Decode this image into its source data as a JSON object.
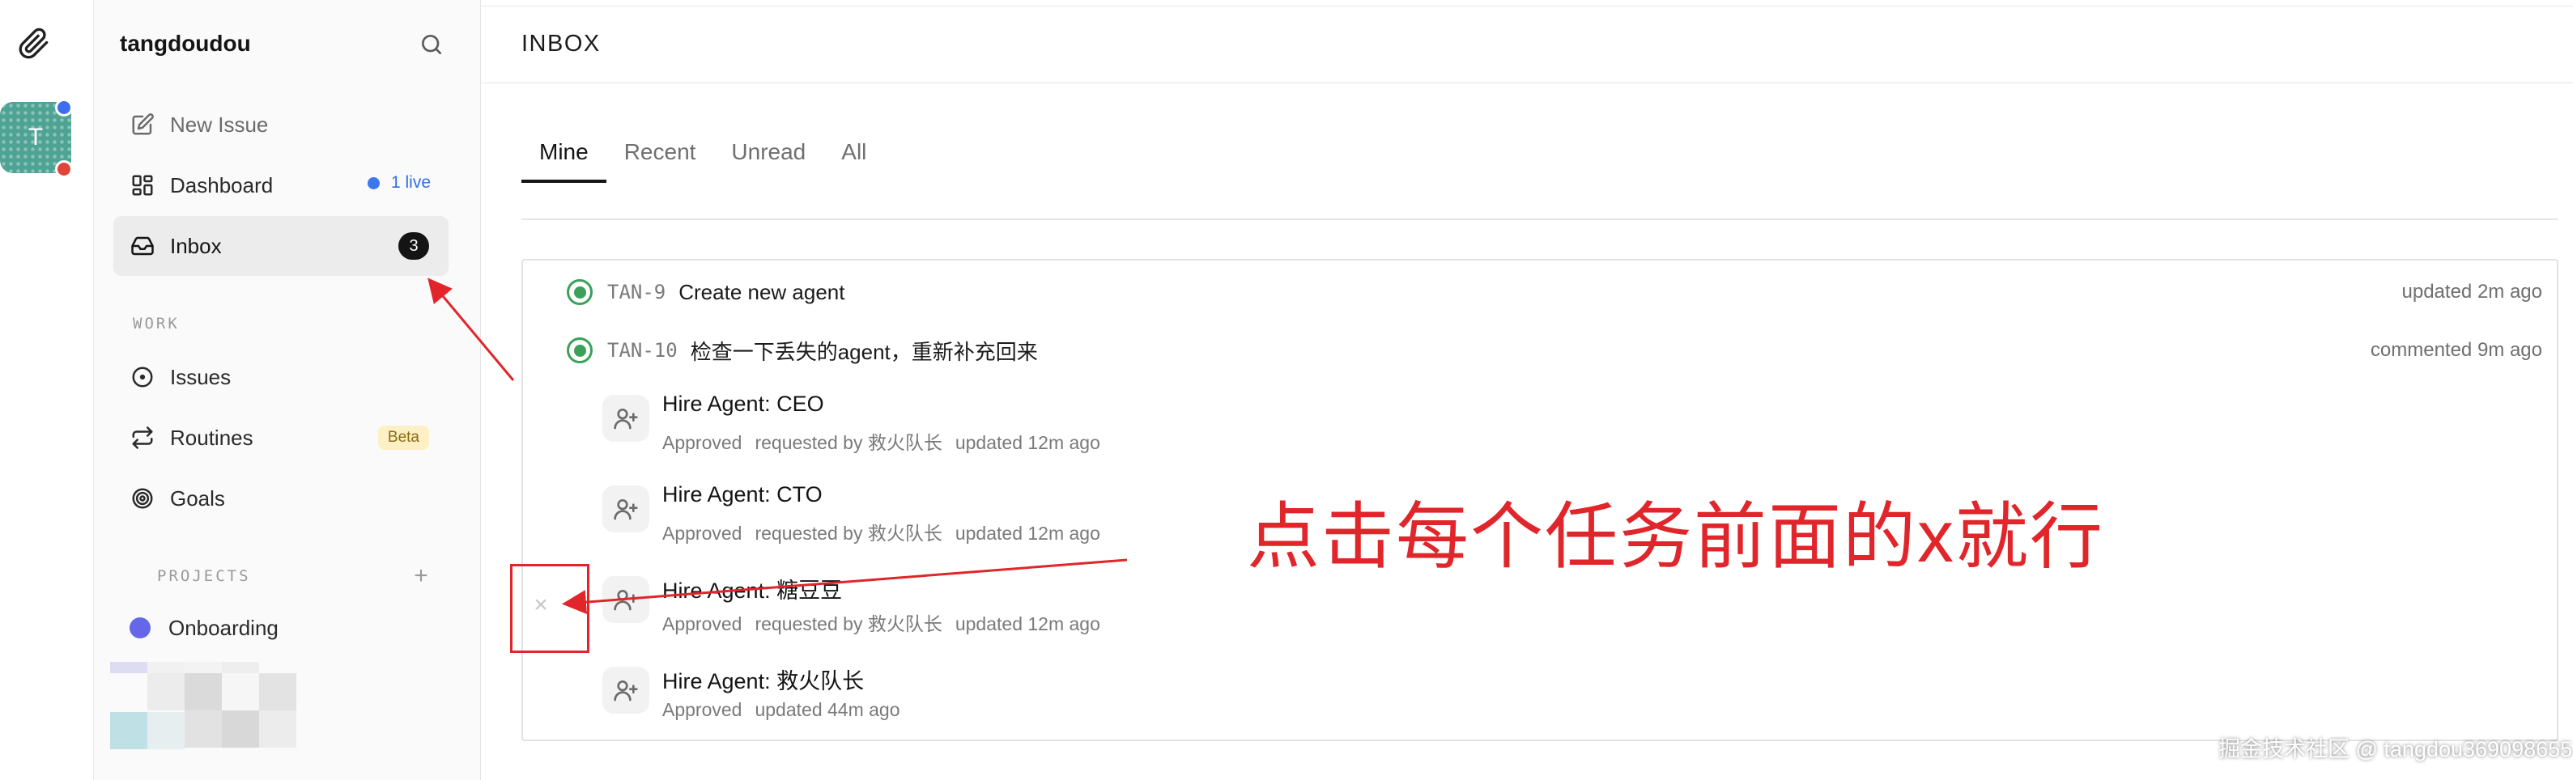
{
  "workspace": {
    "name": "tangdoudou",
    "avatar_letter": "T"
  },
  "sidebar": {
    "items": [
      {
        "label": "New Issue",
        "icon": "edit-icon"
      },
      {
        "label": "Dashboard",
        "icon": "dashboard-icon",
        "live_text": "1 live"
      },
      {
        "label": "Inbox",
        "icon": "inbox-icon",
        "badge": "3",
        "active": true
      }
    ],
    "work_label": "WORK",
    "work_items": [
      {
        "label": "Issues",
        "icon": "issues-icon"
      },
      {
        "label": "Routines",
        "icon": "routines-icon",
        "badge": "Beta"
      },
      {
        "label": "Goals",
        "icon": "goals-icon"
      }
    ],
    "projects_label": "PROJECTS",
    "projects_add": "+",
    "projects": [
      {
        "label": "Onboarding",
        "color": "#6367e8"
      }
    ]
  },
  "page": {
    "title": "INBOX",
    "tabs": [
      "Mine",
      "Recent",
      "Unread",
      "All"
    ],
    "active_tab": "Mine"
  },
  "issues": [
    {
      "id": "TAN-9",
      "title": "Create new agent",
      "time": "updated 2m ago"
    },
    {
      "id": "TAN-10",
      "title": "检查一下丢失的agent，重新补充回来",
      "time": "commented 9m ago"
    }
  ],
  "approvals": [
    {
      "title": "Hire Agent: CEO",
      "status": "Approved",
      "requested": "requested by 救火队长",
      "time": "updated 12m ago"
    },
    {
      "title": "Hire Agent: CTO",
      "status": "Approved",
      "requested": "requested by 救火队长",
      "time": "updated 12m ago"
    },
    {
      "title": "Hire Agent: 糖豆豆",
      "status": "Approved",
      "requested": "requested by 救火队长",
      "time": "updated 12m ago"
    },
    {
      "title": "Hire Agent: 救火队长",
      "status": "Approved",
      "requested": "",
      "time": "updated 44m ago"
    }
  ],
  "dismiss_symbol": "×",
  "annotation": {
    "text": "点击每个任务前面的x就行",
    "color": "#e0262b"
  },
  "watermark": "掘金技术社区 @ tangdou369098655",
  "colors": {
    "accent": "#2f6fe4",
    "success": "#3aa05a",
    "annotation": "#e0262b",
    "project": "#6367e8"
  }
}
